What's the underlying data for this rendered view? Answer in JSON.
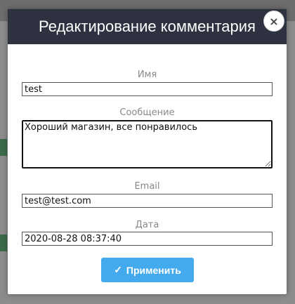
{
  "modal": {
    "title": "Редактирование комментария",
    "close_icon": "×"
  },
  "form": {
    "name_label": "Имя",
    "name_value": "test",
    "message_label": "Сообщение",
    "message_value": "Хороший магазин, все понравилось ",
    "email_label": "Email",
    "email_value": "test@test.com",
    "date_label": "Дата",
    "date_value": "2020-08-28 08:37:40"
  },
  "actions": {
    "apply_label": "Применить",
    "apply_icon": "✓"
  },
  "colors": {
    "header_bg": "#2d3140",
    "apply_bg": "#44aaee"
  }
}
